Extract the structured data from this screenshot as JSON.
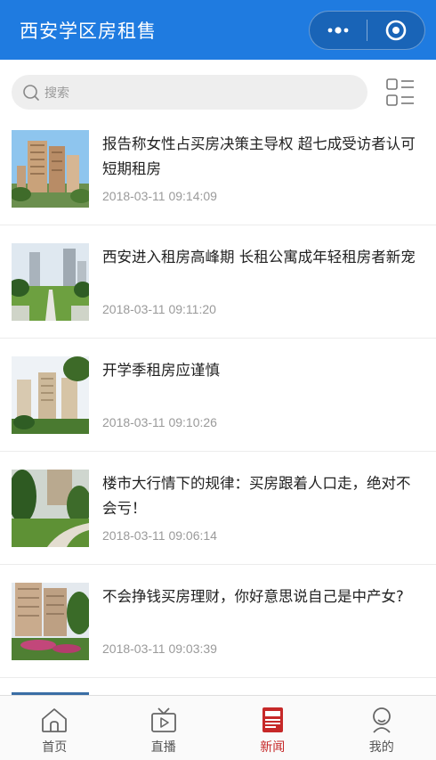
{
  "header": {
    "title": "西安学区房租售",
    "bg_color": "#1f7be0"
  },
  "search": {
    "placeholder": "搜索"
  },
  "news": [
    {
      "title": "报告称女性占买房决策主导权 超七成受访者认可短期租房",
      "date": "2018-03-11 09:14:09"
    },
    {
      "title": "西安进入租房高峰期 长租公寓成年轻租房者新宠",
      "date": "2018-03-11 09:11:20"
    },
    {
      "title": "开学季租房应谨慎",
      "date": "2018-03-11 09:10:26"
    },
    {
      "title": "楼市大行情下的规律：买房跟着人口走，绝对不会亏！",
      "date": "2018-03-11 09:06:14"
    },
    {
      "title": "不会挣钱买房理财，你好意思说自己是中产女?",
      "date": "2018-03-11 09:03:39"
    }
  ],
  "tabbar": {
    "items": [
      {
        "label": "首页",
        "icon": "home-icon",
        "active": false
      },
      {
        "label": "直播",
        "icon": "tv-icon",
        "active": false
      },
      {
        "label": "新闻",
        "icon": "newspaper-icon",
        "active": true
      },
      {
        "label": "我的",
        "icon": "user-icon",
        "active": false
      }
    ],
    "active_color": "#c62828"
  }
}
